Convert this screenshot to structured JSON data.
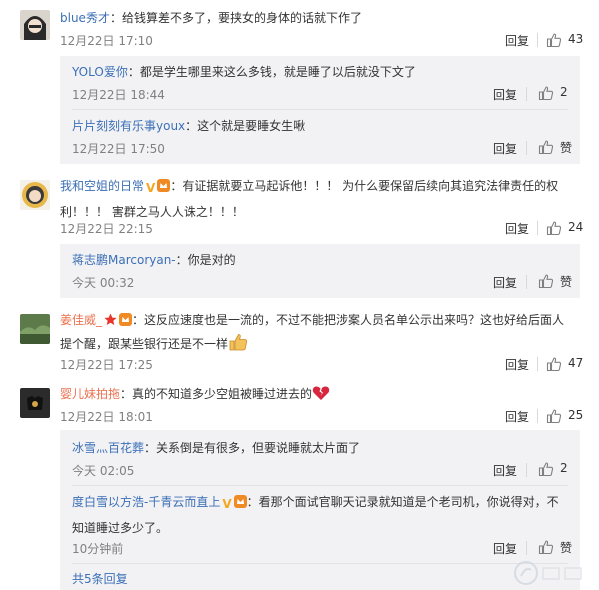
{
  "comments": [
    {
      "user": "blue秀才",
      "text": "：给钱算差不多了，要挟女的身体的话就下作了",
      "time": "12月22日 17:10",
      "reply_label": "回复",
      "likes": "43",
      "subs": [
        {
          "user": "YOLO爱你",
          "text": "：都是学生哪里来这么多钱，就是睡了以后就没下文了",
          "time": "12月22日 18:44",
          "reply_label": "回复",
          "likes": "2"
        },
        {
          "user": "片片刻刻有乐事youx",
          "text": "：这个就是要睡女生啾",
          "time": "12月22日 17:50",
          "reply_label": "回复",
          "likes": "赞"
        }
      ]
    },
    {
      "user": "我和空姐的日常",
      "text_line1": "：有证据就要立马起诉他！！！  为什么要保留后续向其追究法律责任的权",
      "text_line2": "利！！！  害群之马人人诛之！！！",
      "time": "12月22日 22:15",
      "reply_label": "回复",
      "likes": "24",
      "subs": [
        {
          "user": "蒋志鹏Marcoryan-",
          "text": "：你是对的",
          "time": "今天 00:32",
          "reply_label": "回复",
          "likes": "赞"
        }
      ]
    },
    {
      "user": "姜佳威_",
      "text_line1": "：这反应速度也是一流的，不过不能把涉案人员名单公示出来吗？这也好给后面人",
      "text_line2": "提个醒，跟某些银行还是不一样",
      "time": "12月22日 17:25",
      "reply_label": "回复",
      "likes": "47"
    },
    {
      "user": "婴儿妹拍拖",
      "text": "：真的不知道多少空姐被睡过进去的",
      "time": "12月22日 18:01",
      "reply_label": "回复",
      "likes": "25",
      "subs": [
        {
          "user": "冰雪灬百花葬",
          "text": "：关系倒是有很多，但要说睡就太片面了",
          "time": "今天 02:05",
          "reply_label": "回复",
          "likes": "2"
        },
        {
          "user": "度白雪以方浩-千青云而直上",
          "text_line1": "：看那个面试官聊天记录就知道是个老司机，你说得对，不",
          "text_line2": "知道睡过多少了。",
          "time": "10分钟前",
          "reply_label": "回复",
          "likes": "赞"
        }
      ],
      "more_replies": "共5条回复"
    }
  ],
  "colors": {
    "username": "#3b6fb6",
    "subbox": "#f2f2f5",
    "meta": "#808080"
  }
}
